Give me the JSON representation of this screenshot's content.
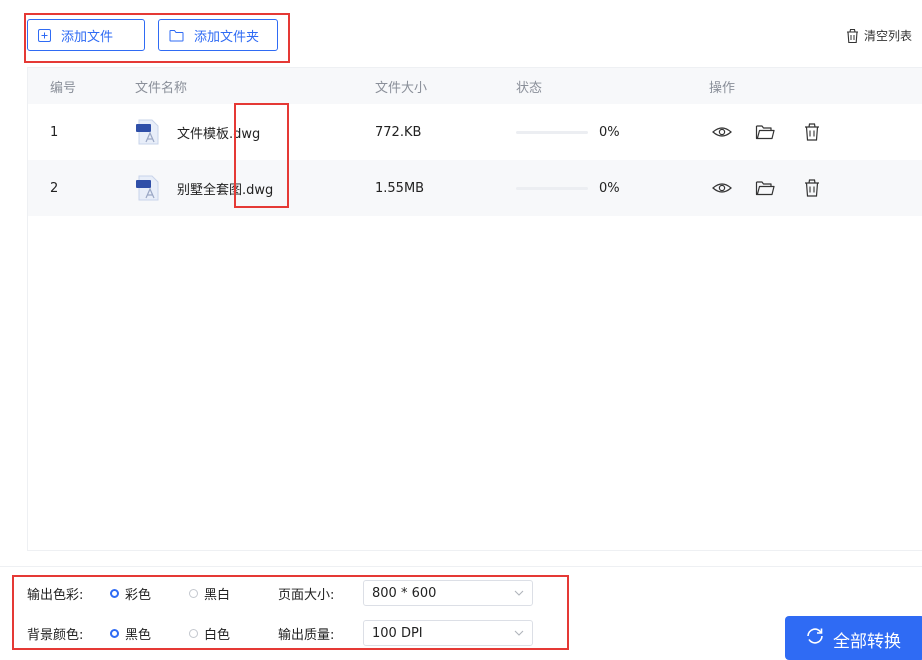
{
  "toolbar": {
    "add_file_label": "添加文件",
    "add_folder_label": "添加文件夹",
    "clear_list_label": "清空列表"
  },
  "table": {
    "headers": [
      "编号",
      "文件名称",
      "文件大小",
      "状态",
      "操作"
    ],
    "rows": [
      {
        "index": "1",
        "name": "文件模板.dwg",
        "size": "772.KB",
        "progress": 0,
        "progress_text": "0%"
      },
      {
        "index": "2",
        "name": "别墅全套图.dwg",
        "size": "1.55MB",
        "progress": 0,
        "progress_text": "0%"
      }
    ]
  },
  "settings": {
    "output_color": {
      "label": "输出色彩:",
      "options": [
        "彩色",
        "黑白"
      ],
      "selected": "彩色"
    },
    "background_color": {
      "label": "背景颜色:",
      "options": [
        "黑色",
        "白色"
      ],
      "selected": "黑色"
    },
    "page_size": {
      "label": "页面大小:",
      "value": "800 * 600"
    },
    "output_quality": {
      "label": "输出质量:",
      "value": "100 DPI"
    }
  },
  "convert_all_label": "全部转换",
  "icons": {
    "add_file": "plus-square-icon",
    "add_folder": "folder-icon",
    "clear": "trash-icon",
    "file_type": "dwg-file-icon",
    "preview": "eye-icon",
    "open_folder": "folder-open-icon",
    "delete": "trash-icon",
    "convert": "refresh-icon",
    "dropdown": "chevron-down-icon"
  },
  "colors": {
    "accent": "#2f6bf4",
    "highlight": "#e53935",
    "header_bg": "#f7f8fa"
  }
}
